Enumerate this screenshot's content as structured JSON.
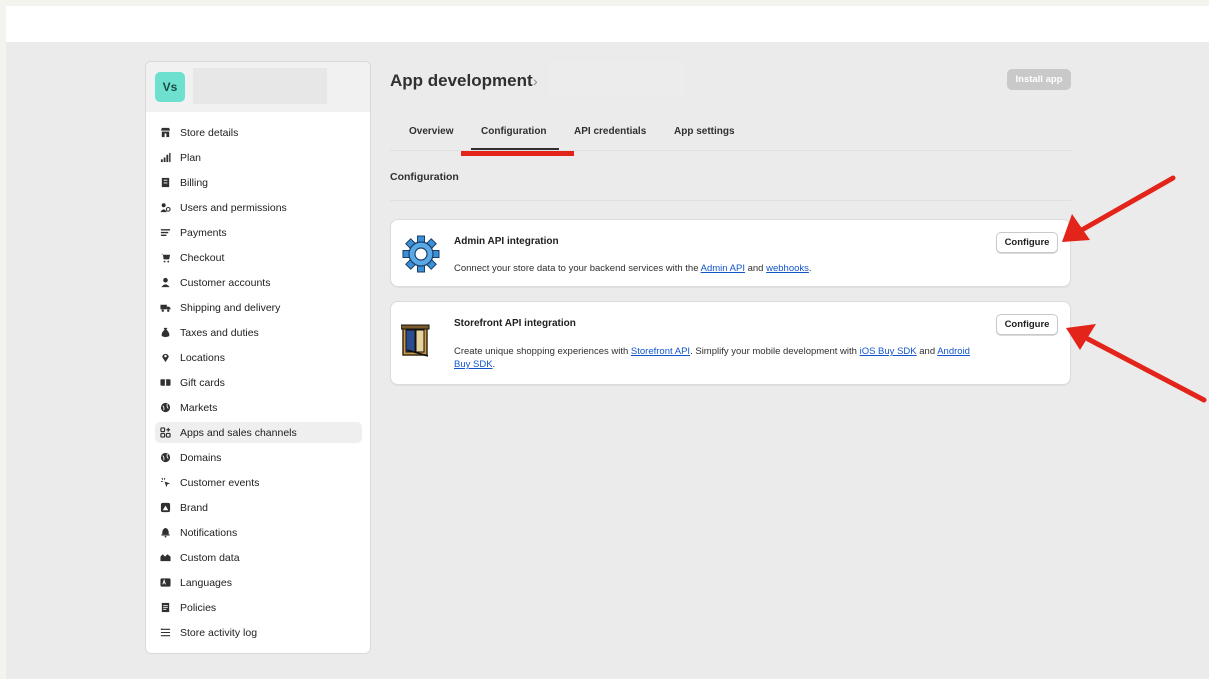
{
  "store": {
    "avatar_initials": "Vs"
  },
  "sidebar": {
    "items": [
      {
        "label": "Store details",
        "icon": "store-icon"
      },
      {
        "label": "Plan",
        "icon": "plan-icon"
      },
      {
        "label": "Billing",
        "icon": "billing-icon"
      },
      {
        "label": "Users and permissions",
        "icon": "users-icon"
      },
      {
        "label": "Payments",
        "icon": "payments-icon"
      },
      {
        "label": "Checkout",
        "icon": "cart-icon"
      },
      {
        "label": "Customer accounts",
        "icon": "person-icon"
      },
      {
        "label": "Shipping and delivery",
        "icon": "truck-icon"
      },
      {
        "label": "Taxes and duties",
        "icon": "tax-icon"
      },
      {
        "label": "Locations",
        "icon": "location-icon"
      },
      {
        "label": "Gift cards",
        "icon": "gift-card-icon"
      },
      {
        "label": "Markets",
        "icon": "globe-icon"
      },
      {
        "label": "Apps and sales channels",
        "icon": "apps-icon"
      },
      {
        "label": "Domains",
        "icon": "globe-icon"
      },
      {
        "label": "Customer events",
        "icon": "cursor-click-icon"
      },
      {
        "label": "Brand",
        "icon": "brand-icon"
      },
      {
        "label": "Notifications",
        "icon": "bell-icon"
      },
      {
        "label": "Custom data",
        "icon": "custom-data-icon"
      },
      {
        "label": "Languages",
        "icon": "language-icon"
      },
      {
        "label": "Policies",
        "icon": "policies-icon"
      },
      {
        "label": "Store activity log",
        "icon": "list-icon"
      }
    ],
    "active_label": "Apps and sales channels"
  },
  "header": {
    "breadcrumb_title": "App development",
    "chevron": "›",
    "install_label": "Install app"
  },
  "tabs": {
    "overview": "Overview",
    "configuration": "Configuration",
    "api_credentials": "API credentials",
    "app_settings": "App settings",
    "active": "Configuration"
  },
  "section": {
    "title": "Configuration"
  },
  "admin_card": {
    "title": "Admin API integration",
    "desc_pre": "Connect your store data to your backend services with the ",
    "link1": "Admin API",
    "mid": " and ",
    "link2": "webhooks",
    "end": ".",
    "button": "Configure",
    "icon": "gear-icon"
  },
  "storefront_card": {
    "title": "Storefront API integration",
    "desc_pre": "Create unique shopping experiences with ",
    "link1": "Storefront API",
    "mid1": ". Simplify your mobile development with ",
    "link2": "iOS Buy SDK",
    "mid2": " and ",
    "link3": "Android Buy SDK",
    "end": ".",
    "button": "Configure",
    "icon": "storefront-icon"
  },
  "colors": {
    "annotation_red": "#e3241b",
    "avatar": "#6ee0cf",
    "link": "#1155cc"
  }
}
